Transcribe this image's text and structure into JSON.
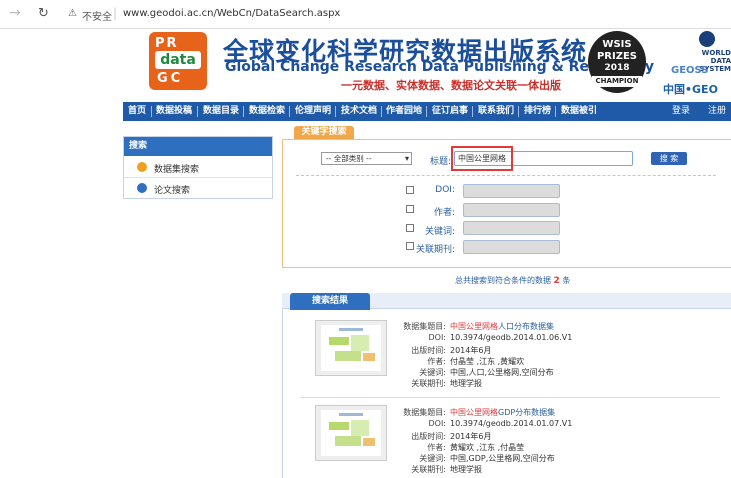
{
  "browser": {
    "security_label": "不安全",
    "url": "www.geodoi.ac.cn/WebCn/DataSearch.aspx"
  },
  "header": {
    "logo": {
      "line1": "PR",
      "line2": "data",
      "line3": "GC"
    },
    "title_cn": "全球变化科学研究数据出版系统",
    "title_en": "Global Change Research Data Publishing & Repository",
    "slogan": "一元数据、实体数据、数据论文关联一体出版",
    "wsis": {
      "line1": "WSIS",
      "line2": "PRIZES",
      "line3": "2018",
      "line4": "CHAMPION"
    },
    "wds": "WORLD DATA SYSTEM",
    "geoss": "GEOSS",
    "geo": "中国•GEO"
  },
  "nav": {
    "items": [
      "首页",
      "数据投稿",
      "数据目录",
      "数据检索",
      "伦理声明",
      "技术文档",
      "作者园地",
      "征订启事",
      "联系我们",
      "排行榜",
      "数据被引"
    ],
    "login": "登录",
    "register": "注册"
  },
  "sidebar": {
    "title": "搜索",
    "items": [
      {
        "label": "数据集搜索",
        "color": "#f0a020"
      },
      {
        "label": "论文搜索",
        "color": "#2f6fc0"
      }
    ]
  },
  "keyword_search": {
    "tab": "关键字搜索",
    "category_selected": "-- 全部类别 --",
    "title_label": "标题:",
    "title_value": "中国公里网格",
    "search_button": "搜 索",
    "fields": [
      {
        "label": "DOI:"
      },
      {
        "label": "作者:"
      },
      {
        "label": "关键词:"
      },
      {
        "label": "关联期刊:"
      }
    ]
  },
  "total": {
    "prefix": "总共搜索到符合条件的数据",
    "count": "2",
    "suffix": "条"
  },
  "results": {
    "tab": "搜索结果",
    "labels": {
      "title": "数据集题目:",
      "doi": "DOI:",
      "date": "出版时间:",
      "author": "作者:",
      "keywords": "关键词:",
      "journal": "关联期刊:"
    },
    "items": [
      {
        "title_hl": "中国公里网格",
        "title_rest": "人口分布数据集",
        "doi": "10.3974/geodb.2014.01.06.V1",
        "date": "2014年6月",
        "authors": "付晶莹 ,江东 ,黄耀欢",
        "keywords": "中国,人口,公里格网,空间分布",
        "journal": "地理学报"
      },
      {
        "title_hl": "中国公里网格",
        "title_rest": "GDP分布数据集",
        "doi": "10.3974/geodb.2014.01.07.V1",
        "date": "2014年6月",
        "authors": "黄耀欢 ,江东 ,付晶莹",
        "keywords": "中国,GDP,公里格网,空间分布",
        "journal": "地理学报"
      }
    ]
  }
}
